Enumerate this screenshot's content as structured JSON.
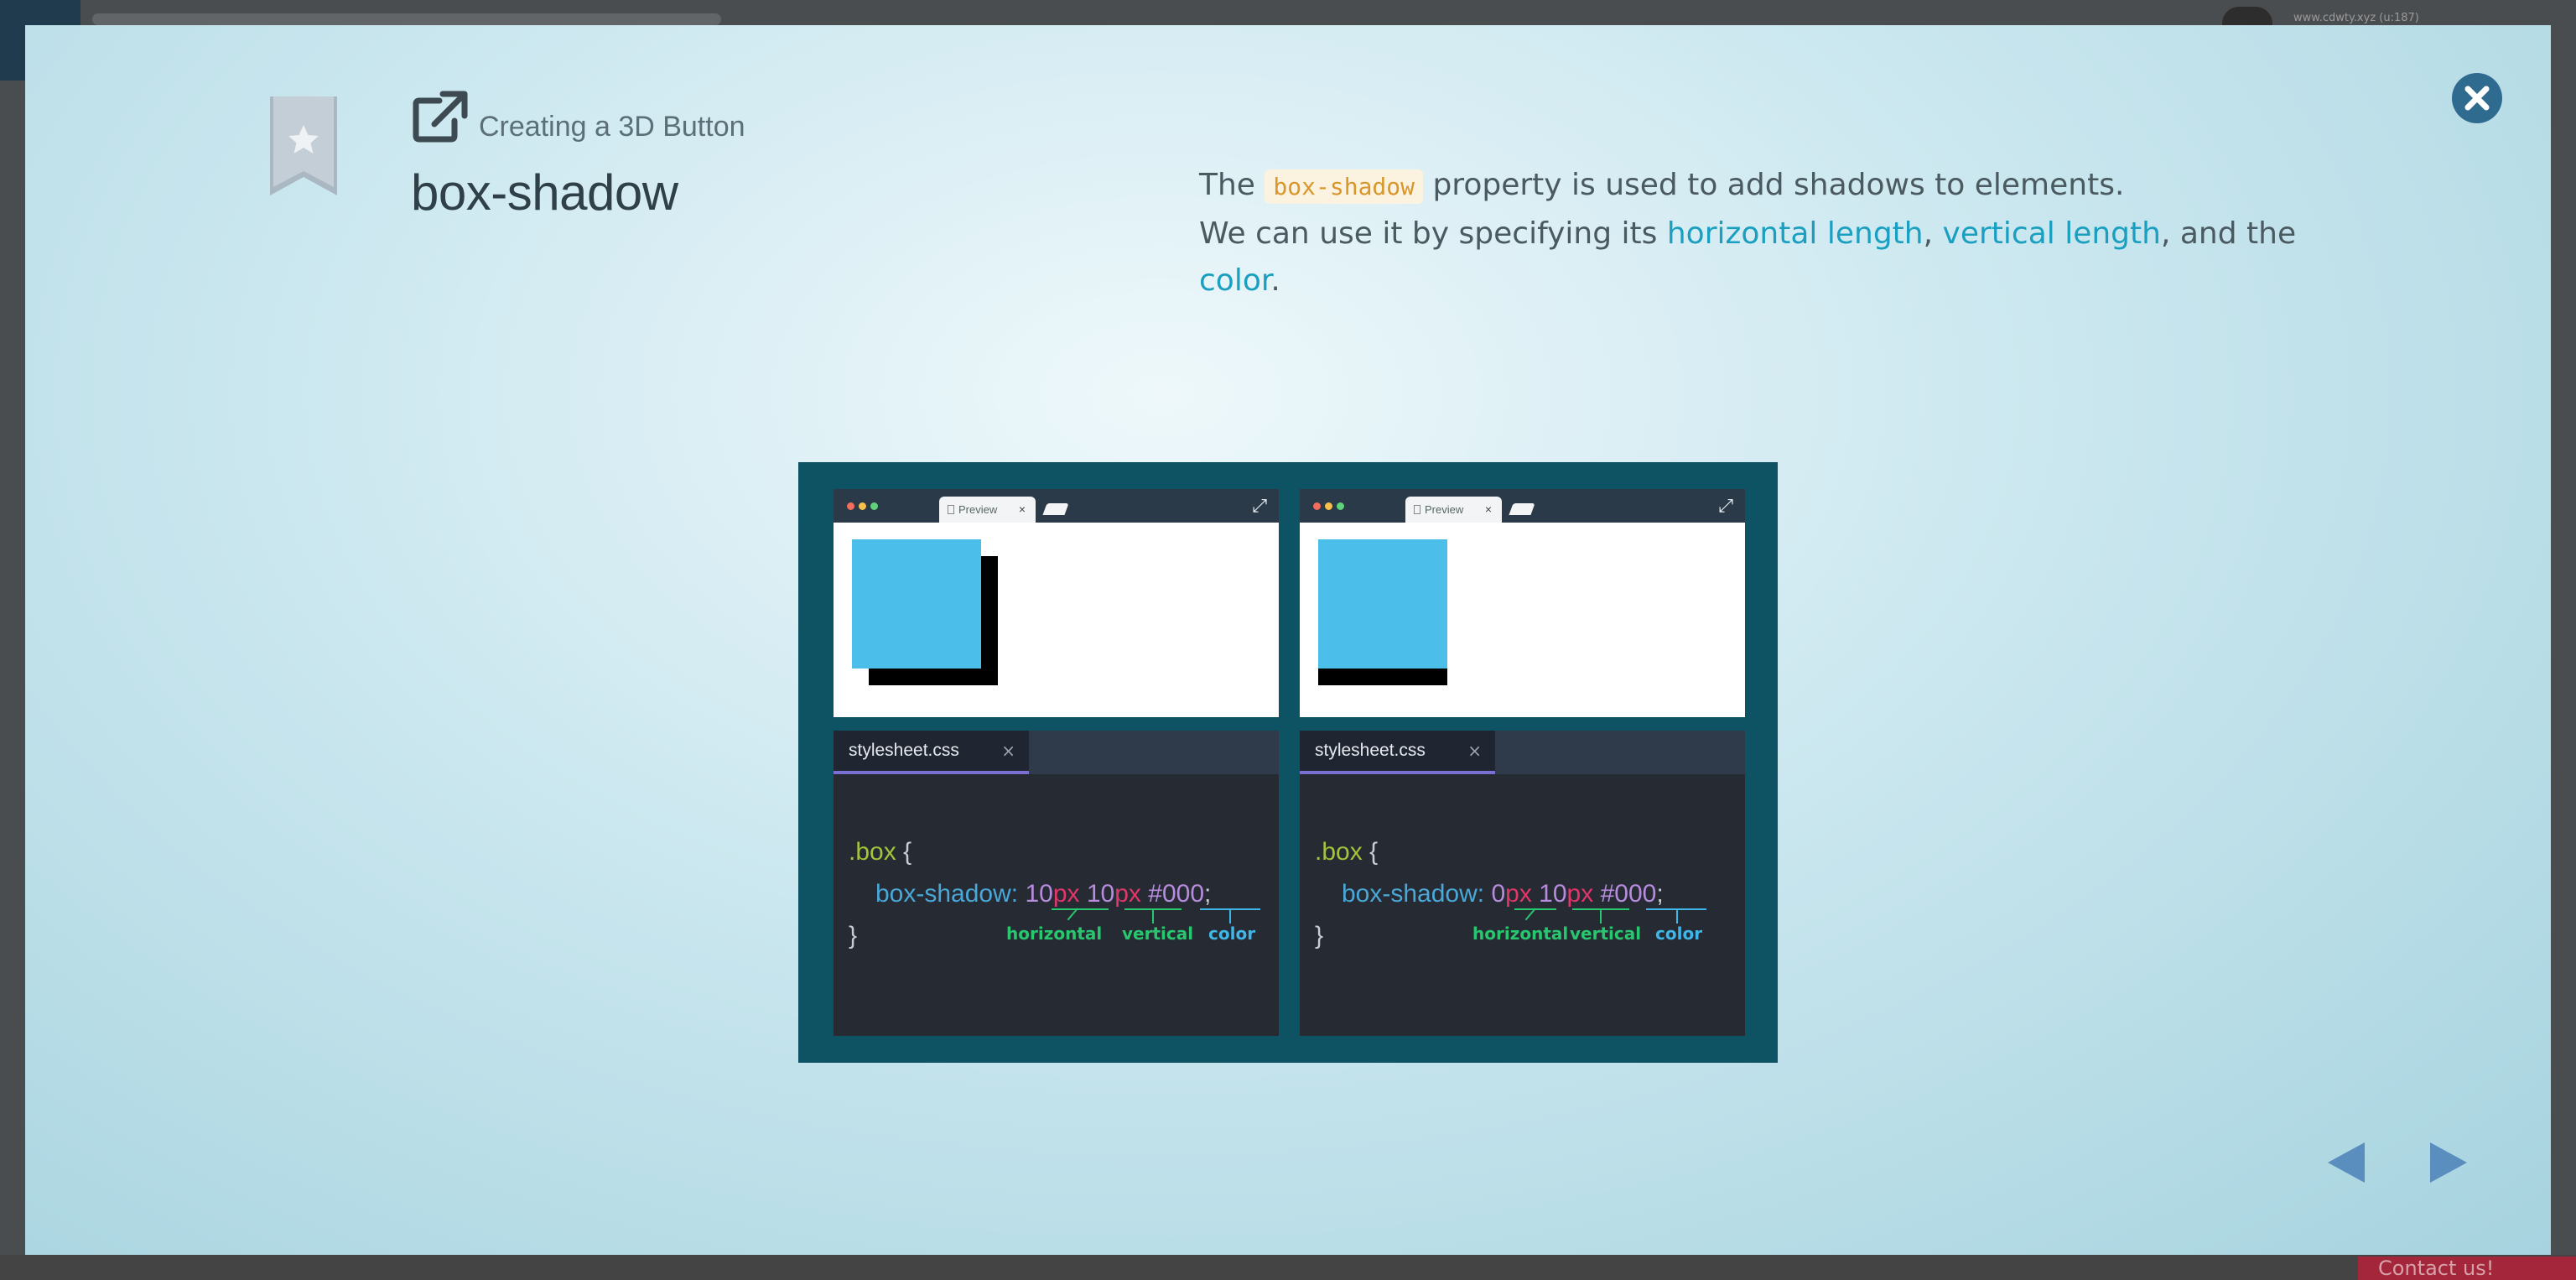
{
  "background": {
    "url_text": "www.cdwty.xyz (u:187)",
    "contact_label": "Contact us!"
  },
  "modal": {
    "lesson_title": "Creating a 3D Button",
    "page_title": "box-shadow",
    "description": {
      "part1": "The",
      "code": "box-shadow",
      "part2": "property is used to add shadows to elements.",
      "part3": "We can use it by specifying its",
      "term1": "horizontal length",
      "sep1": ",",
      "term2": "vertical length",
      "part4": ", and the",
      "term3": "color",
      "end": "."
    }
  },
  "illustration": {
    "panels": [
      {
        "preview_tab": "Preview",
        "tab_close": "×",
        "file_tab": "stylesheet.css",
        "file_close": "×",
        "selector": ".box",
        "open_brace": "{",
        "property": "box-shadow:",
        "h_num": "10",
        "h_unit": "px",
        "v_num": "10",
        "v_unit": "px",
        "color": "#000",
        "semicolon": ";",
        "close_brace": "}",
        "ann_h": "horizontal",
        "ann_v": "vertical",
        "ann_c": "color"
      },
      {
        "preview_tab": "Preview",
        "tab_close": "×",
        "file_tab": "stylesheet.css",
        "file_close": "×",
        "selector": ".box",
        "open_brace": "{",
        "property": "box-shadow:",
        "h_num": "0",
        "h_unit": "px",
        "v_num": "10",
        "v_unit": "px",
        "color": "#000",
        "semicolon": ";",
        "close_brace": "}",
        "ann_h": "horizontal",
        "ann_v": "vertical",
        "ann_c": "color"
      }
    ]
  },
  "colors": {
    "accent": "#1a9fc1",
    "box": "#4bbfe9",
    "illustration_bg": "#0d5364",
    "close_button": "#2f6b8f"
  },
  "icons": {
    "bookmark": "bookmark-star-icon",
    "external": "external-link-icon",
    "close": "close-icon",
    "prev": "arrow-left-icon",
    "next": "arrow-right-icon"
  }
}
